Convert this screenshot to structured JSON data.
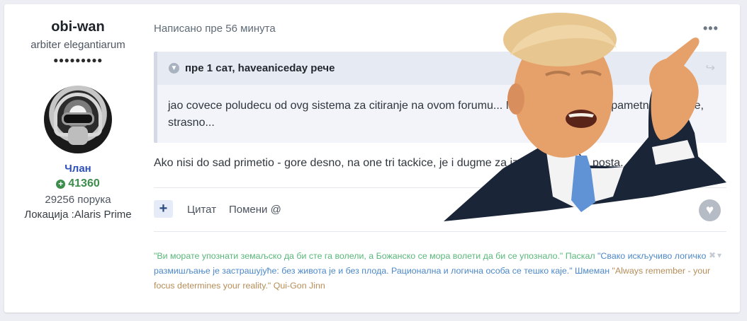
{
  "author": {
    "name": "obi-wan",
    "title": "arbiter elegantiarum",
    "rank_pips": "●●●●●●●●●",
    "group": "Члан",
    "reputation": "41360",
    "posts": "29256 порука",
    "location": "Локација :Alaris Prime"
  },
  "post": {
    "meta": "Написано пре 56 минута",
    "more_label": "•••",
    "quote": {
      "header": "пре 1 сат, haveaniceday рече",
      "body": "jao covece poludecu od ovg sistema za citiranje na ovom forumu... Ne mogu da nadjem pametnije resenje, strasno..."
    },
    "content": "Ako nisi do sad primetio - gore desno, na one tri tackice, je i dugme za izmenu/brisanje posta."
  },
  "actions": {
    "add_label": "+",
    "quote_label": "Цитат",
    "mention_label": "Помени @"
  },
  "signature": {
    "line1": "\"Ви морате упознати земаљско да би сте га волели, а Божанско се мора волети да би се упознало.\" Паскал",
    "line2": "\"Свако искључиво логичко размишљање је застрашујуће: без живота је и без плода. Рационална и логична особа се тешко каје.\" Шмеман",
    "line3": "\"Always remember - your focus determines your reality.\" Qui-Gon Jinn"
  },
  "colors": {
    "group": "#2d50b8",
    "reputation": "#3d8d4c",
    "sig_green": "#58b87a",
    "sig_blue": "#4d88c8",
    "sig_tan": "#b68d58"
  },
  "icons": {
    "reputation": "plus-circle-icon",
    "quote_toggle": "chevron-down-icon",
    "quote_share": "share-arrow-icon",
    "reaction": "heart-icon",
    "signature_controls": "close-icon"
  }
}
